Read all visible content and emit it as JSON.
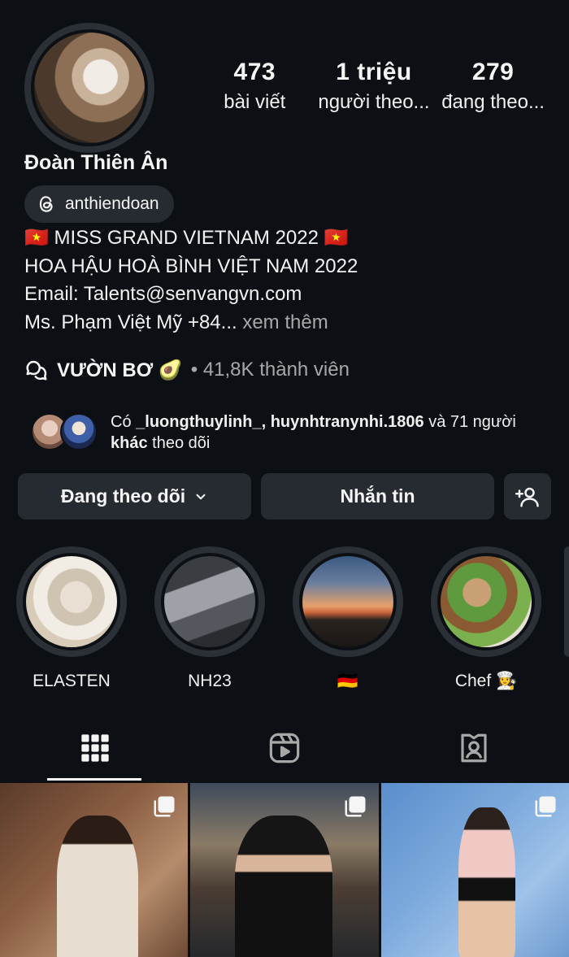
{
  "profile": {
    "name": "Đoàn Thiên Ân",
    "threads_handle": "anthiendoan",
    "stats": [
      {
        "value": "473",
        "label": "bài viết"
      },
      {
        "value": "1 triệu",
        "label": "người theo..."
      },
      {
        "value": "279",
        "label": "đang theo..."
      }
    ],
    "bio": {
      "line1": "🇻🇳 MISS GRAND VIETNAM 2022 🇻🇳",
      "line2": "HOA HẬU HOÀ BÌNH VIỆT NAM 2022",
      "line3": "Email: Talents@senvangvn.com",
      "line4": "Ms. Phạm Việt Mỹ +84...",
      "more": "xem thêm"
    },
    "community": {
      "name": "VƯỜN BƠ 🥑",
      "meta": "• 41,8K thành viên"
    },
    "mutual": {
      "prefix": "Có",
      "names": "_luongthuylinh_, huynhtranynhi.1806",
      "middle": "và 71 người",
      "bold_tail": "khác",
      "suffix": "theo dõi"
    }
  },
  "actions": {
    "following_label": "Đang theo dõi",
    "message_label": "Nhắn tin"
  },
  "highlights": [
    {
      "label": "ELASTEN"
    },
    {
      "label": "NH23"
    },
    {
      "label": "🇩🇪"
    },
    {
      "label": "Chef 👩‍🍳"
    }
  ],
  "tabs": [
    {
      "icon": "grid-icon",
      "active": true
    },
    {
      "icon": "reels-icon",
      "active": false
    },
    {
      "icon": "tagged-icon",
      "active": false
    }
  ],
  "colors": {
    "background": "#0c1014",
    "button": "#262a31",
    "muted": "#a8a8a8"
  }
}
